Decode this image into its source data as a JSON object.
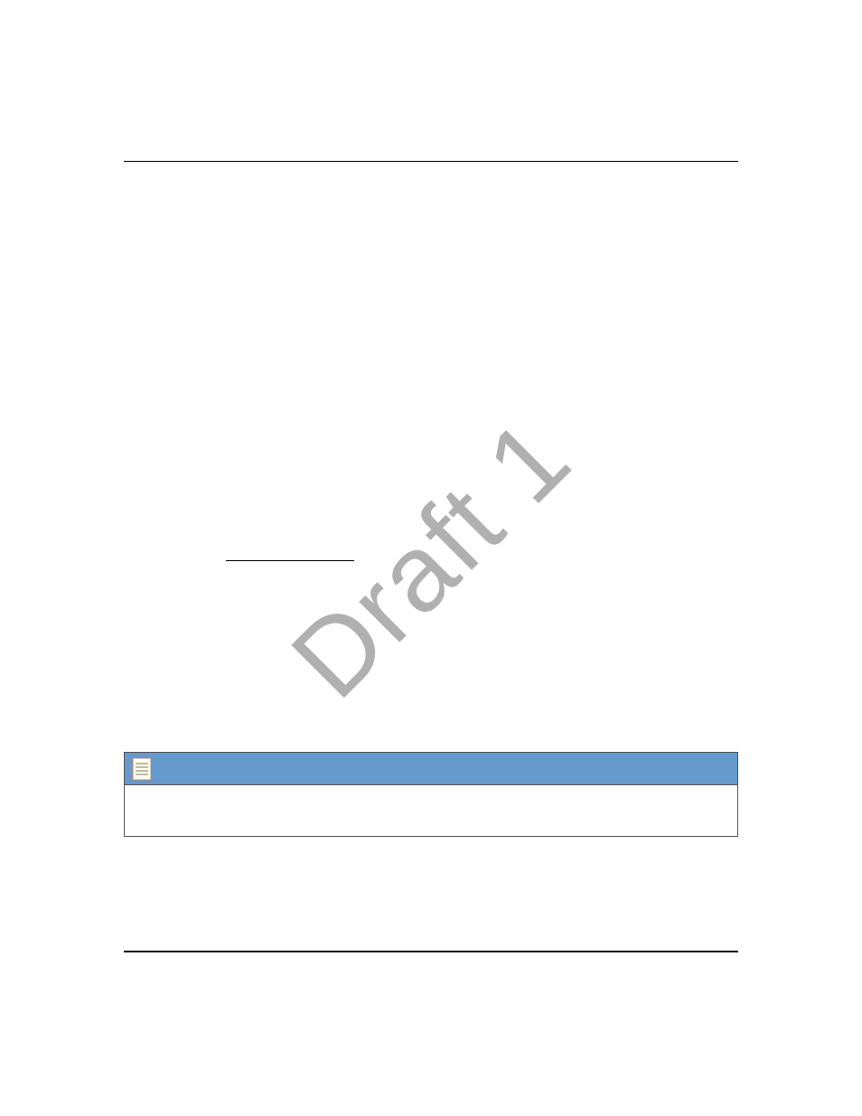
{
  "watermark": "Draft 1"
}
